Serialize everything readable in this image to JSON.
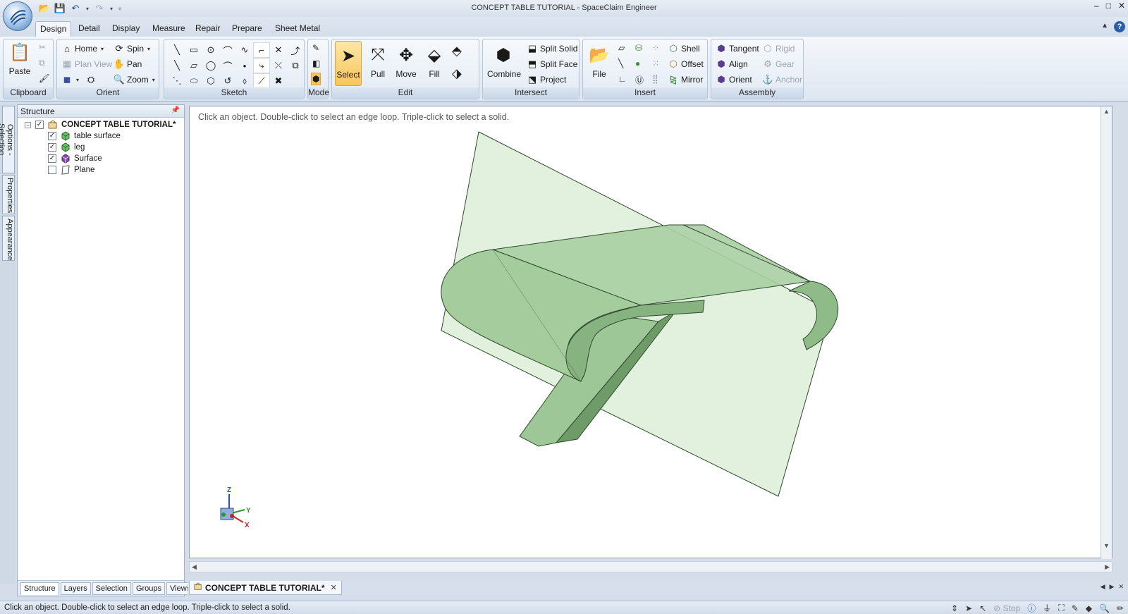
{
  "window": {
    "title": "CONCEPT TABLE TUTORIAL - SpaceClaim Engineer",
    "minimize": "–",
    "maximize": "□",
    "close": "✕"
  },
  "quick_access": [
    "open-icon",
    "save-icon",
    "undo-icon",
    "redo-icon",
    "customize-icon"
  ],
  "ribbon_tabs": [
    "Design",
    "Detail",
    "Display",
    "Measure",
    "Repair",
    "Prepare",
    "Sheet Metal"
  ],
  "active_tab": "Design",
  "ribbon": {
    "clipboard": {
      "label": "Clipboard",
      "paste": "Paste"
    },
    "orient": {
      "label": "Orient",
      "home": "Home",
      "spin": "Spin",
      "plan_view": "Plan View",
      "pan": "Pan",
      "zoom": "Zoom"
    },
    "sketch": {
      "label": "Sketch"
    },
    "mode": {
      "label": "Mode"
    },
    "edit": {
      "label": "Edit",
      "select": "Select",
      "pull": "Pull",
      "move": "Move",
      "fill": "Fill"
    },
    "intersect": {
      "label": "Intersect",
      "combine": "Combine",
      "split_solid": "Split Solid",
      "split_face": "Split Face",
      "project": "Project"
    },
    "insert": {
      "label": "Insert",
      "file": "File",
      "shell": "Shell",
      "offset": "Offset",
      "mirror": "Mirror"
    },
    "assembly": {
      "label": "Assembly",
      "tangent": "Tangent",
      "align": "Align",
      "orient": "Orient",
      "rigid": "Rigid",
      "gear": "Gear",
      "anchor": "Anchor"
    }
  },
  "side_tabs": [
    "Options - Selection",
    "Properties",
    "Appearance"
  ],
  "structure": {
    "title": "Structure",
    "root": {
      "label": "CONCEPT TABLE TUTORIAL*",
      "checked": true
    },
    "items": [
      {
        "label": "table surface",
        "checked": true,
        "icon": "solid-body-icon"
      },
      {
        "label": "leg",
        "checked": true,
        "icon": "solid-body-icon"
      },
      {
        "label": "Surface",
        "checked": true,
        "icon": "surface-body-icon"
      },
      {
        "label": "Plane",
        "checked": false,
        "icon": "plane-icon"
      }
    ],
    "bottom_tabs": [
      "Structure",
      "Layers",
      "Selection",
      "Groups",
      "Views"
    ]
  },
  "viewport": {
    "hint": "Click an object. Double-click to select an edge loop. Triple-click to select a solid.",
    "axis_labels": {
      "x": "X",
      "y": "Y",
      "z": "Z"
    }
  },
  "document_tab": {
    "label": "CONCEPT TABLE TUTORIAL*"
  },
  "status": {
    "text": "Click an object. Double-click to select an edge loop. Triple-click to select a solid.",
    "stop": "Stop"
  },
  "colors": {
    "model_fill": "#a9cfa3",
    "model_edge": "#2f4a2c",
    "plane_fill": "#d7ecd3",
    "selected_tool": "#f8c55a"
  }
}
